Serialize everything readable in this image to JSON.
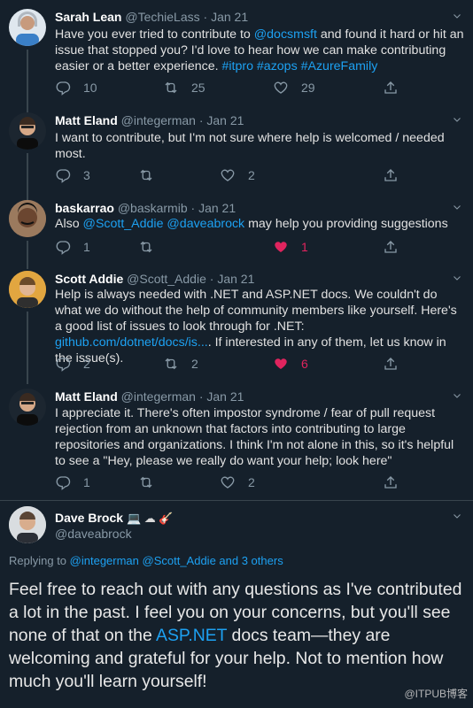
{
  "colors": {
    "background": "#15202b",
    "link": "#1da1f2",
    "like": "#e0245e",
    "muted": "#8899a6"
  },
  "tweets": [
    {
      "name": "Sarah Lean",
      "handle": "@TechieLass",
      "date": "· Jan 21",
      "body_parts": [
        "Have you ever tried to contribute to ",
        "@docsmsft",
        " and found it hard or hit an issue that stopped you? I'd love to hear how we can make contributing easier or a better experience. ",
        "#itpro #azops #AzureFamily"
      ],
      "replies": "10",
      "retweets": "25",
      "likes": "29"
    },
    {
      "name": "Matt Eland",
      "handle": "@integerman",
      "date": "· Jan 21",
      "body": "I want to contribute, but I'm not sure where help is welcomed / needed most.",
      "replies": "3",
      "retweets": "",
      "likes": "2"
    },
    {
      "name": "baskarrao",
      "handle": "@baskarmib",
      "date": "· Jan 21",
      "body_parts": [
        "Also ",
        "@Scott_Addie  @daveabrock",
        " may help you providing suggestions"
      ],
      "replies": "1",
      "retweets": "",
      "likes": "1"
    },
    {
      "name": "Scott Addie",
      "handle": "@Scott_Addie",
      "date": "· Jan 21",
      "body_parts": [
        "Help is always needed with .NET and ASP.NET docs. We couldn't do what we do without the help of community members like yourself. Here's a good list of issues to look through for .NET: ",
        "github.com/dotnet/docs/is...",
        ". If interested in any of them, let us know in the issue(s)."
      ],
      "replies": "2",
      "retweets": "2",
      "likes": "6"
    },
    {
      "name": "Matt Eland",
      "handle": "@integerman",
      "date": "· Jan 21",
      "body": "I appreciate it. There's often impostor syndrome / fear of pull request rejection from an unknown that factors into contributing to large repositories and organizations. I think I'm not alone in this, so it's helpful to see a \"Hey, please we really do want your help; look here\"",
      "replies": "1",
      "retweets": "",
      "likes": "2"
    }
  ],
  "main_tweet": {
    "name": "Dave Brock",
    "emojis": "💻 ☁ 🎸",
    "handle": "@daveabrock",
    "replying_prefix": "Replying to ",
    "replying_to": "@integerman @Scott_Addie and 3 others",
    "body_parts": [
      "Feel free to reach out with any questions as I've contributed a lot in the past. I feel you on your concerns, but you'll see none of that on the ",
      "ASP.NET",
      " docs team—they are welcoming and grateful for your help. Not to mention how much you'll learn yourself!"
    ]
  },
  "watermark": "@ITPUB博客"
}
